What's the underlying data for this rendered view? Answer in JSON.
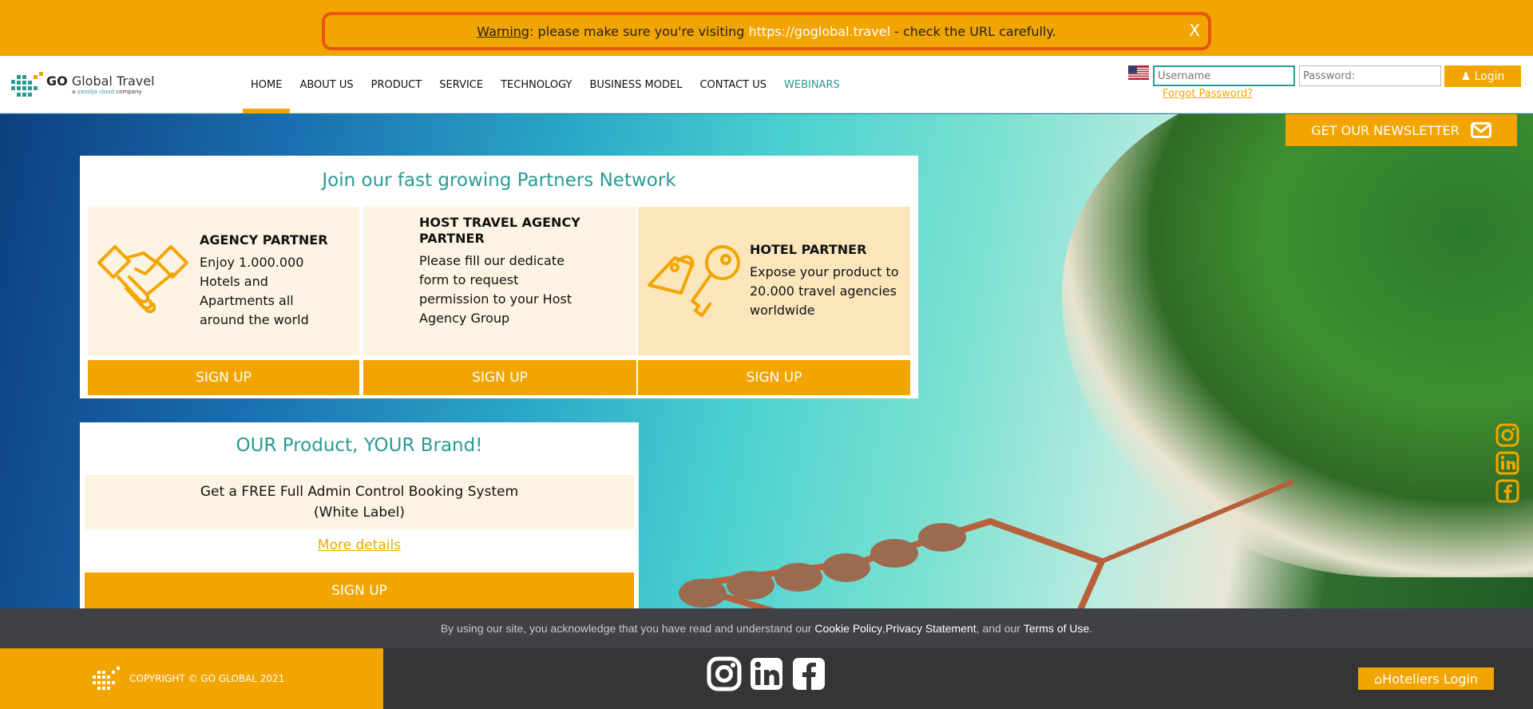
{
  "warning": {
    "label": "Warning",
    "text_before": ": please make sure you're visiting ",
    "url": "https://goglobal.travel",
    "text_after": " - check the URL carefully.",
    "close": "X"
  },
  "brand": {
    "title_bold": "GO",
    "title_rest": " Global Travel",
    "sub_before": "a ",
    "sub_company": "yanolja cloud",
    "sub_after": " company"
  },
  "nav": {
    "items": [
      "HOME",
      "ABOUT US",
      "PRODUCT",
      "SERVICE",
      "TECHNOLOGY",
      "BUSINESS MODEL",
      "CONTACT US",
      "WEBINARS"
    ],
    "active": "HOME"
  },
  "login": {
    "username_placeholder": "Username",
    "password_placeholder": "Password:",
    "button": "Login",
    "forgot": "Forgot Password?"
  },
  "newsletter": {
    "label": "GET OUR NEWSLETTER"
  },
  "partners": {
    "title": "Join our fast growing Partners Network",
    "cards": [
      {
        "title": "AGENCY PARTNER",
        "desc": "Enjoy 1.000.000 Hotels and Apartments all around the world",
        "signup": "SIGN UP"
      },
      {
        "title": "HOST TRAVEL AGENCY PARTNER",
        "desc": "Please fill our dedicate form to request permission to your Host Agency Group",
        "signup": "SIGN UP"
      },
      {
        "title": "HOTEL PARTNER",
        "desc": "Expose your product to 20.000 travel agencies worldwide",
        "signup": "SIGN UP"
      }
    ]
  },
  "product": {
    "title": "OUR Product, YOUR Brand!",
    "line1": "Get a FREE Full Admin Control Booking System",
    "line2": "(White Label)",
    "more": "More details",
    "signup": "SIGN UP"
  },
  "cookie": {
    "text1": "By using our site, you acknowledge that you have read and understand our ",
    "cookie_policy": "Cookie Policy",
    "sep1": ", ",
    "privacy": "Privacy Statement",
    "sep2": ", and our ",
    "terms": "Terms of Use",
    "end": "."
  },
  "footer": {
    "copyright": "COPYRIGHT © GO GLOBAL 2021",
    "hoteliers_login": "Hoteliers Login"
  },
  "colors": {
    "accent": "#f2a500",
    "teal": "#2a9a94",
    "warning_border": "#e8550f"
  },
  "icons": [
    "handshake-icon",
    "key-tag-icon",
    "envelope-icon",
    "instagram-icon",
    "linkedin-icon",
    "facebook-icon",
    "user-icon",
    "home-icon",
    "us-flag-icon"
  ]
}
